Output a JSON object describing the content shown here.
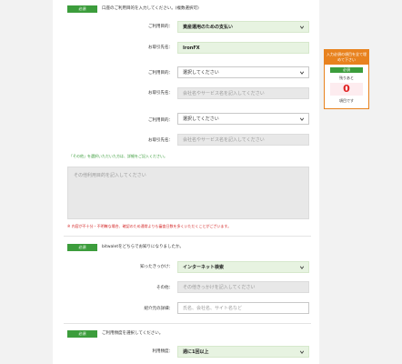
{
  "sections": [
    {
      "badge": "必須",
      "title": "口座のご利用目的を入力してください。(複数選択可)"
    },
    {
      "badge": "必須",
      "title": "bitwaletをどちらでお知りになりましたか。"
    },
    {
      "badge": "必須",
      "title": "ご利用頻度を選択してください。"
    }
  ],
  "purpose1": {
    "label": "ご利用目的：",
    "value": "資産運用のための支払い"
  },
  "dest1": {
    "label": "お取引先名：",
    "value": "IronFX"
  },
  "purpose2": {
    "label": "ご利用目的：",
    "value": "選択してください"
  },
  "dest2": {
    "label": "お取引先名：",
    "placeholder": "会社名やサービス名を記入してください"
  },
  "purpose3": {
    "label": "ご利用目的：",
    "value": "選択してください"
  },
  "dest3": {
    "label": "お取引先名：",
    "placeholder": "会社名やサービス名を記入してください"
  },
  "other_note": "「その他」を選択いただいた方は、詳細をご記入ください。",
  "other_textarea": {
    "placeholder": "その他利用目的を記入してください"
  },
  "warning": "※ 内容が不十分・不明瞭な場合、確認のため通常よりも審査日数を多くいただくことがございます。",
  "trigger": {
    "label": "知ったきっかけ：",
    "value": "インターネット検索"
  },
  "trigger_other": {
    "label": "その他：",
    "placeholder": "その他きっかけを記入してください"
  },
  "referrer": {
    "label": "紹介元の詳細：",
    "placeholder": "氏名、会社名、サイト名など"
  },
  "frequency": {
    "label": "利用頻度：",
    "value": "週に1回以上"
  },
  "sidebar": {
    "heading": "入力必須の項目を全て埋めて下さい",
    "badge": "必須",
    "remaining_label": "残りあと",
    "count": "0",
    "unit": "項目です"
  },
  "colors": {
    "accent_green": "#3c9d3c",
    "warning_red": "#d42a2a",
    "sidebar_orange": "#e8821e"
  }
}
